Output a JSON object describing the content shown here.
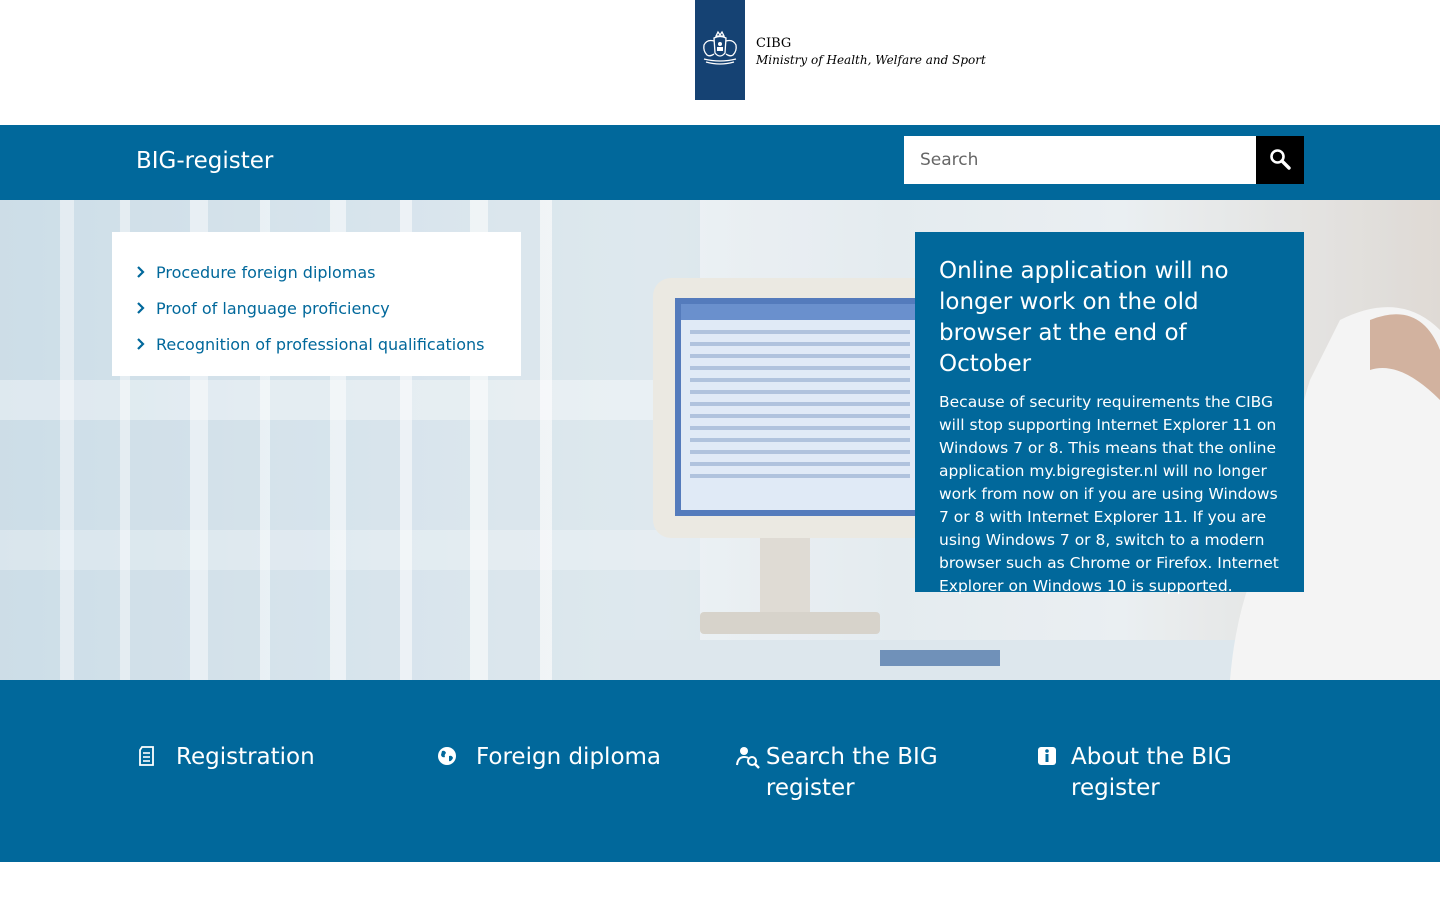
{
  "header": {
    "org_name": "CIBG",
    "ministry_name": "Ministry of Health, Welfare and Sport",
    "logo_icon": "coat-of-arms-icon"
  },
  "topbar": {
    "site_title": "BIG-register",
    "search": {
      "placeholder": "Search",
      "value": "",
      "button_icon": "search-icon"
    }
  },
  "hero": {
    "links": [
      {
        "label": "Procedure foreign diplomas"
      },
      {
        "label": "Proof of language proficiency"
      },
      {
        "label": "Recognition of professional qualifications"
      }
    ],
    "notice": {
      "title": "Online application will no longer work on the old browser at the end of October",
      "body": "Because of security requirements the CIBG will stop supporting Internet Explorer 11 on Windows 7 or 8. This means that the online application my.bigregister.nl will no longer work from now on if you are using Windows 7 or 8 with Internet Explorer 11. If you are using Windows 7 or 8, switch to a modern browser such as Chrome or Firefox. Internet Explorer on Windows 10 is supported."
    }
  },
  "tiles": [
    {
      "label": "Registration",
      "icon": "document-icon"
    },
    {
      "label": "Foreign diploma",
      "icon": "globe-icon"
    },
    {
      "label": "Search the BIG register",
      "icon": "person-search-icon"
    },
    {
      "label": "About the BIG register",
      "icon": "info-icon"
    }
  ],
  "colors": {
    "brand_blue": "#01689b",
    "logo_blue": "#154273",
    "search_button": "#000000"
  }
}
